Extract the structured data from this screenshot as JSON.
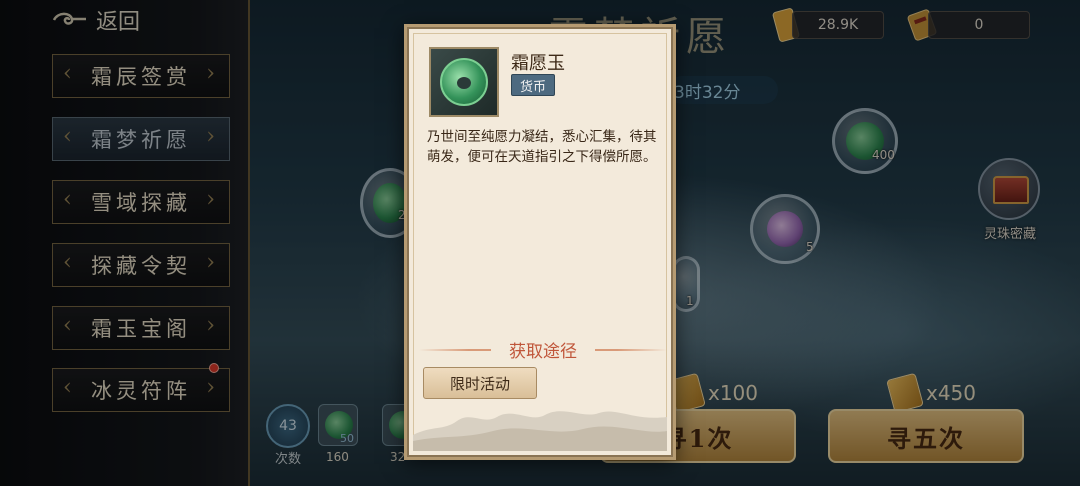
{
  "sidebar": {
    "back_label": "返回",
    "items": [
      {
        "label": "霜辰签赏",
        "active": false
      },
      {
        "label": "霜梦祈愿",
        "active": true
      },
      {
        "label": "雪域探藏",
        "active": false
      },
      {
        "label": "探藏令契",
        "active": false
      },
      {
        "label": "霜玉宝阁",
        "active": false
      },
      {
        "label": "冰灵符阵",
        "active": false,
        "badge": true
      }
    ]
  },
  "header": {
    "title": "霜梦祈愿",
    "resources": [
      {
        "icon": "gold-token-icon",
        "value": "28.9K"
      },
      {
        "icon": "scroll-ticket-icon",
        "value": "0"
      }
    ],
    "timer": "3时32分"
  },
  "scene": {
    "bubble_counts": [
      "400",
      "5",
      "1",
      "2"
    ],
    "treasure_button_label": "灵珠密藏"
  },
  "bottom": {
    "draw_count": "43",
    "draw_count_label": "次数",
    "rewards": [
      {
        "qty": "50",
        "caption": "160"
      },
      {
        "qty": "",
        "caption": "32"
      }
    ],
    "single": {
      "cost": "x100",
      "label": "寻1次"
    },
    "five": {
      "cost": "x450",
      "label": "寻五次"
    }
  },
  "modal": {
    "item_name": "霜愿玉",
    "item_tag": "货币",
    "item_description": "乃世间至纯愿力凝结，悉心汇集，待其萌发，便可在天道指引之下得偿所愿。",
    "section_title": "获取途径",
    "source_button": "限时活动"
  },
  "colors": {
    "modal_bg": "#f3eadb",
    "accent_red": "#c0563a",
    "tag_blue": "#4d6a80",
    "button_gold": "#e9c685"
  }
}
